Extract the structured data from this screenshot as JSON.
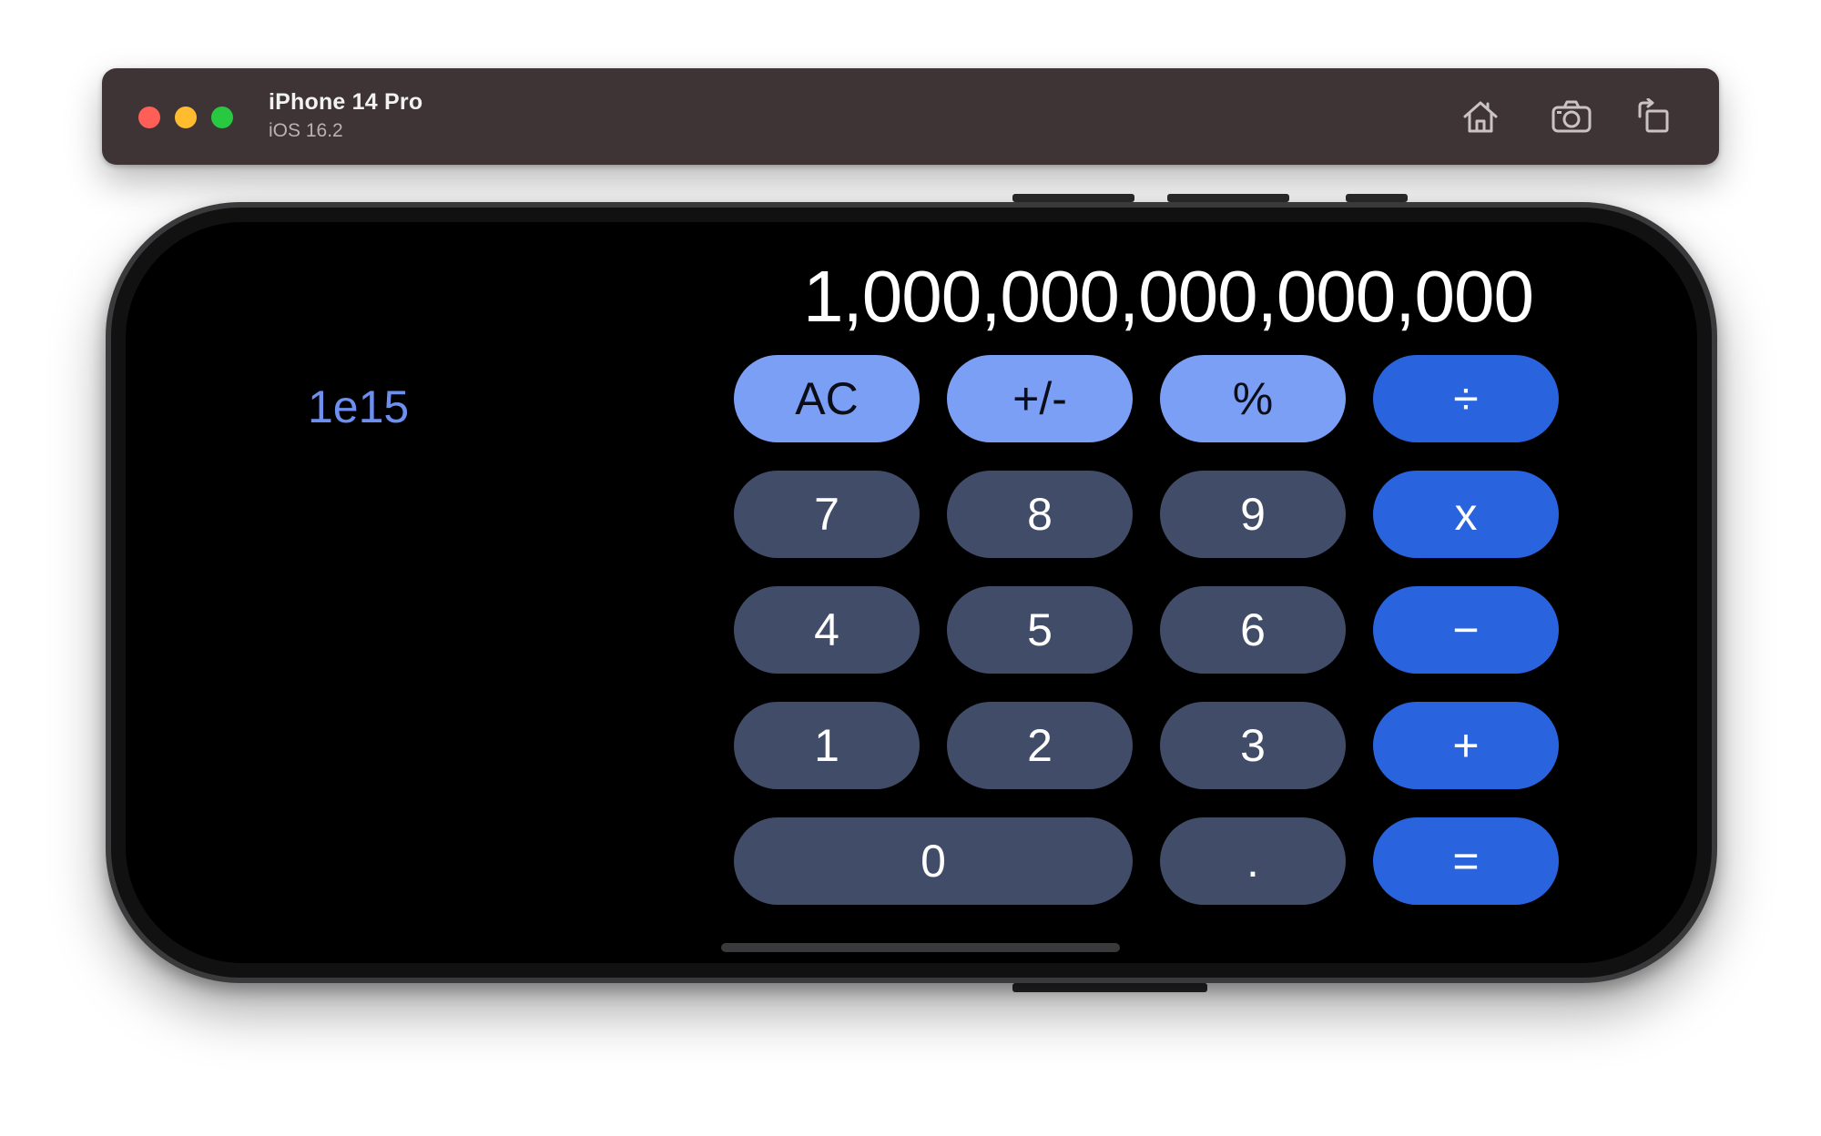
{
  "simulator": {
    "device_name": "iPhone 14 Pro",
    "os_version": "iOS 16.2",
    "toolbar": {
      "home_icon": "home-icon",
      "screenshot_icon": "camera-icon",
      "rotate_icon": "rotate-icon"
    },
    "window_controls": [
      "close",
      "minimize",
      "zoom"
    ]
  },
  "calculator": {
    "display_value": "1,000,000,000,000,000",
    "expression": "1e15",
    "keys": {
      "ac": "AC",
      "sign": "+/-",
      "percent": "%",
      "divide": "÷",
      "seven": "7",
      "eight": "8",
      "nine": "9",
      "multiply": "x",
      "four": "4",
      "five": "5",
      "six": "6",
      "subtract": "−",
      "one": "1",
      "two": "2",
      "three": "3",
      "add": "+",
      "zero": "0",
      "decimal": ".",
      "equals": "="
    }
  },
  "colors": {
    "function_key": "#7b9ff5",
    "digit_key": "#414c68",
    "operator_key": "#2a63de",
    "expression_text": "#6d8ff0",
    "screen_background": "#000000"
  }
}
